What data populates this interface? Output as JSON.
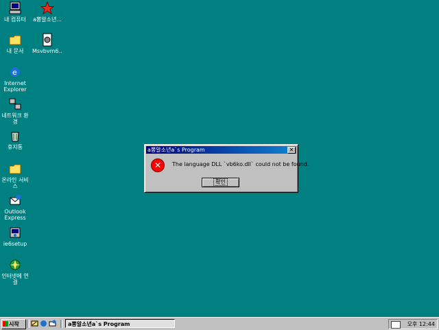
{
  "desktop": {
    "icons": [
      {
        "label": "내 컴퓨터",
        "icon": "my-computer-icon"
      },
      {
        "label": "a뽕알소년...",
        "icon": "star-shortcut-icon"
      },
      {
        "label": "내 문서",
        "icon": "my-documents-folder-icon"
      },
      {
        "label": "Msvbvm6...",
        "icon": "installer-file-icon"
      },
      {
        "label": "Internet Explorer",
        "icon": "internet-explorer-icon"
      },
      {
        "label": "네트워크 환경",
        "icon": "network-neighborhood-icon"
      },
      {
        "label": "휴지통",
        "icon": "recycle-bin-icon"
      },
      {
        "label": "온라인 서비스",
        "icon": "online-services-folder-icon"
      },
      {
        "label": "Outlook Express",
        "icon": "outlook-express-icon"
      },
      {
        "label": "ie6setup",
        "icon": "ie6setup-icon"
      },
      {
        "label": "인터넷에 연결",
        "icon": "connect-to-internet-icon"
      }
    ]
  },
  "dialog": {
    "title": "a뽕알소년a`s Program",
    "close_glyph": "✕",
    "error_glyph": "✕",
    "message": "The language DLL `vb6ko.dll` could not be found.",
    "ok_label": "확인"
  },
  "taskbar": {
    "start_label": "시작",
    "task_label": "a뽕알소년a`s Program",
    "clock": "오후 12:44"
  },
  "colors": {
    "desktop": "#008080",
    "title_active": "#000080",
    "error_red": "#ff0000"
  }
}
